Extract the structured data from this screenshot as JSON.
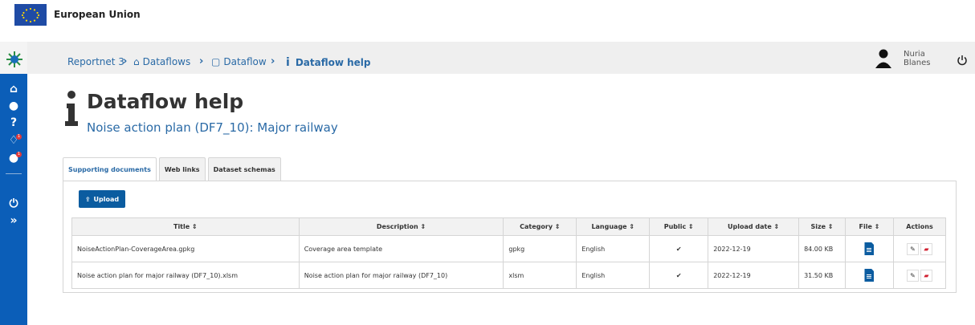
{
  "top": {
    "org": "European Union"
  },
  "header": {
    "breadcrumbs": [
      {
        "label": "Reportnet 3",
        "icon": ""
      },
      {
        "label": "Dataflows",
        "icon": "home"
      },
      {
        "label": "Dataflow",
        "icon": "clone"
      },
      {
        "label": "Dataflow help",
        "icon": "info"
      }
    ],
    "user": {
      "first": "Nuria",
      "last": "Blanes"
    }
  },
  "page": {
    "title": "Dataflow help",
    "subtitle": "Noise action plan (DF7_10): Major railway"
  },
  "tabs": [
    "Supporting documents",
    "Web links",
    "Dataset schemas"
  ],
  "toolbar": {
    "upload_label": "Upload"
  },
  "table": {
    "headers": [
      "Title",
      "Description",
      "Category",
      "Language",
      "Public",
      "Upload date",
      "Size",
      "File",
      "Actions"
    ],
    "rows": [
      {
        "title": "NoiseActionPlan-CoverageArea.gpkg",
        "description": "Coverage area template",
        "category": "gpkg",
        "language": "English",
        "public": "✔",
        "date": "2022-12-19",
        "size": "84.00 KB"
      },
      {
        "title": "Noise action plan for major railway (DF7_10).xlsm",
        "description": "Noise action plan for major railway (DF7_10)",
        "category": "xlsm",
        "language": "English",
        "public": "✔",
        "date": "2022-12-19",
        "size": "31.50 KB"
      }
    ]
  },
  "colors": {
    "brand": "#0b5ca0",
    "sidebar": "#0b5eb8",
    "link": "#2a6aa6",
    "danger": "#d01f2f"
  },
  "sidebar_badges": [
    "1",
    "1"
  ]
}
